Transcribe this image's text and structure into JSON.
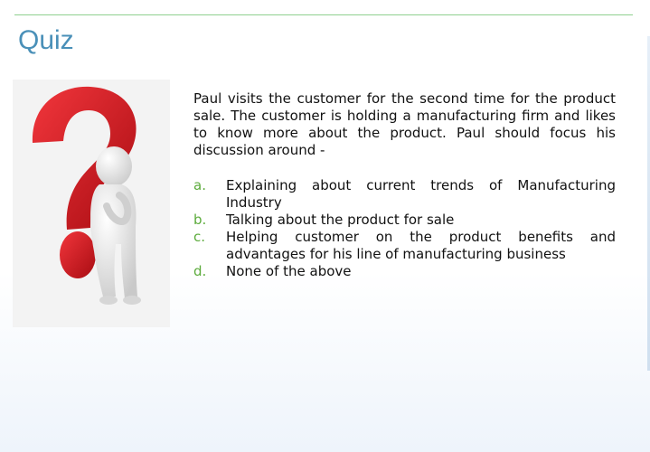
{
  "slide": {
    "title": "Quiz",
    "question": "Paul visits the customer for the second time for the product sale. The customer is holding a manufacturing firm and likes to know more about the product. Paul should focus his discussion around -",
    "options": [
      {
        "letter": "a.",
        "text": "Explaining about current trends of Manufacturing Industry"
      },
      {
        "letter": "b.",
        "text": "Talking about the product for sale"
      },
      {
        "letter": "c.",
        "text": "Helping customer on the product benefits and advantages for his line of manufacturing business"
      },
      {
        "letter": "d.",
        "text": "None of the above"
      }
    ]
  },
  "colors": {
    "title": "#4a90b8",
    "option_letter": "#5cab3c",
    "rule": "#8fd08f",
    "question_mark": "#d8141c"
  },
  "illustration": {
    "icon": "question-mark-figure-icon"
  }
}
